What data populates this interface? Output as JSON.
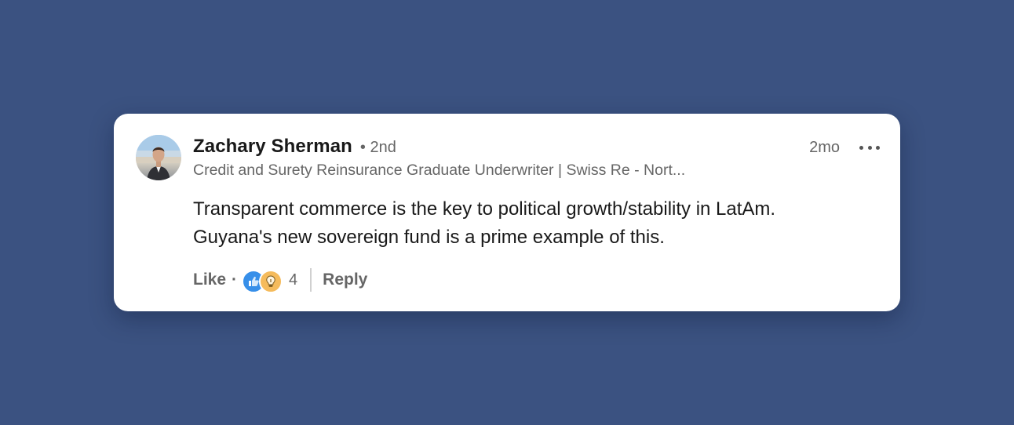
{
  "comment": {
    "author_name": "Zachary Sherman",
    "connection_degree": "• 2nd",
    "headline": "Credit and Surety Reinsurance Graduate Underwriter | Swiss Re - Nort...",
    "timestamp": "2mo",
    "text_lines": [
      "Transparent commerce is the key to political growth/stability in LatAm.",
      "Guyana's new sovereign fund is a prime example of this."
    ]
  },
  "actions": {
    "like_label": "Like",
    "separator": "·",
    "reactions": [
      "like-icon",
      "insightful-icon"
    ],
    "reaction_count": "4",
    "reply_label": "Reply"
  },
  "colors": {
    "background": "#3b5281",
    "card": "#ffffff",
    "like_reaction": "#378fe9",
    "insightful_reaction": "#f5bb5c"
  }
}
